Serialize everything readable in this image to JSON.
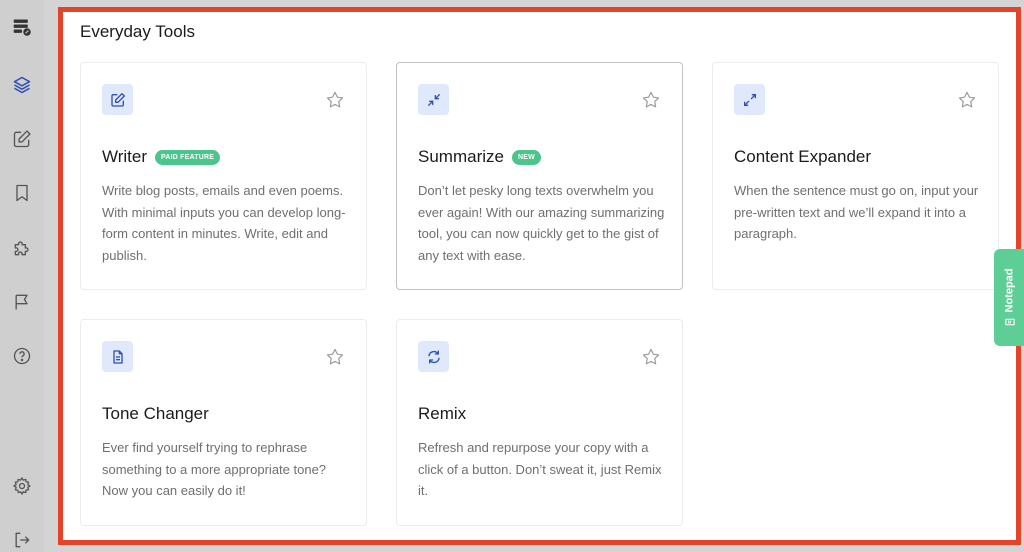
{
  "sidebar": {
    "icons": [
      "logo-icon",
      "layers-icon",
      "edit-icon",
      "bookmark-icon",
      "puzzle-icon",
      "flag-icon",
      "help-icon",
      "settings-icon",
      "logout-icon"
    ]
  },
  "section": {
    "title": "Everyday Tools"
  },
  "cards": [
    {
      "title": "Writer",
      "badge": "PAID FEATURE",
      "icon": "pencil-square-icon",
      "description": "Write blog posts, emails and even poems. With minimal inputs you can develop long-form content in minutes. Write, edit and publish."
    },
    {
      "title": "Summarize",
      "badge": "NEW",
      "icon": "collapse-arrows-icon",
      "description": "Don’t let pesky long texts overwhelm you ever again! With our amazing summarizing tool, you can now quickly get to the gist of any text with ease."
    },
    {
      "title": "Content Expander",
      "badge": "",
      "icon": "expand-arrows-icon",
      "description": "When the sentence must go on, input your pre-written text and we’ll expand it into a paragraph."
    },
    {
      "title": "Tone Changer",
      "badge": "",
      "icon": "document-icon",
      "description": "Ever find yourself trying to rephrase something to a more appropriate tone? Now you can easily do it!"
    },
    {
      "title": "Remix",
      "badge": "",
      "icon": "refresh-icon",
      "description": "Refresh and repurpose your copy with a click of a button. Don’t sweat it, just Remix it."
    }
  ],
  "notepad": {
    "label": "Notepad"
  },
  "colors": {
    "accent": "#2f4fb5",
    "icon_bg": "#e0e8fb",
    "badge": "#4bc48d",
    "notepad": "#5dcf96",
    "highlight_border": "#e4432b"
  }
}
